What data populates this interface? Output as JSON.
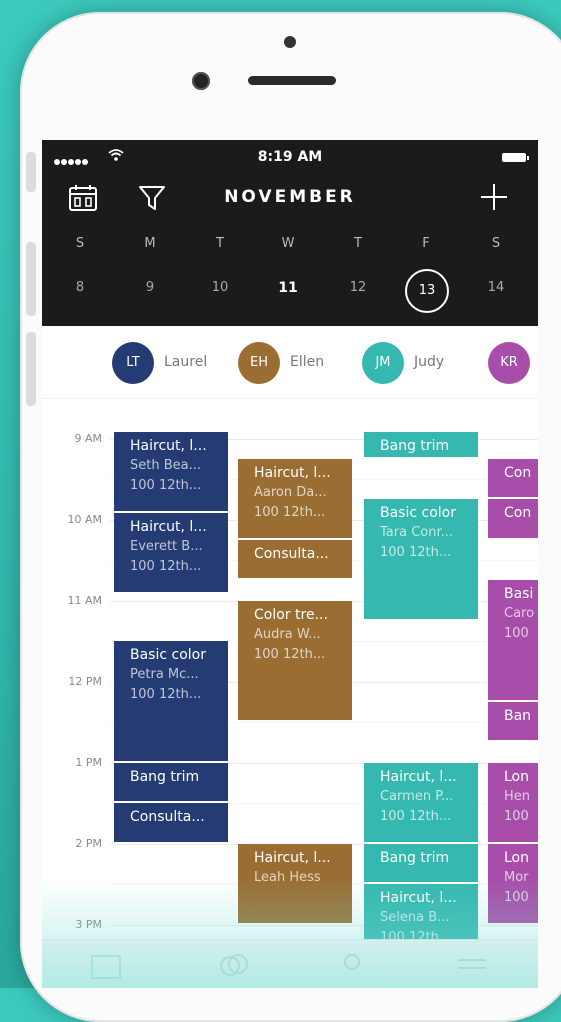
{
  "status_bar": {
    "time": "8:19 AM"
  },
  "header": {
    "month": "NOVEMBER"
  },
  "week": {
    "days": [
      "S",
      "M",
      "T",
      "W",
      "T",
      "F",
      "S"
    ],
    "dates": [
      "8",
      "9",
      "10",
      "11",
      "12",
      "13",
      "14"
    ],
    "today_index": 3,
    "selected_index": 5
  },
  "staff": [
    {
      "initials": "LT",
      "name": "Laurel",
      "color": "#243b73"
    },
    {
      "initials": "EH",
      "name": "Ellen",
      "color": "#9a6e33"
    },
    {
      "initials": "JM",
      "name": "Judy",
      "color": "#35b8b0"
    },
    {
      "initials": "KR",
      "name": "",
      "color": "#a84eaa"
    }
  ],
  "hours": [
    "9 AM",
    "10 AM",
    "11 AM",
    "12 PM",
    "1 PM",
    "2 PM",
    "3 PM"
  ],
  "appointments": [
    {
      "col": 0,
      "start": 8.92,
      "end": 9.92,
      "title": "Haircut, l...",
      "lines": [
        "Seth Bea...",
        "100 12th..."
      ]
    },
    {
      "col": 0,
      "start": 9.92,
      "end": 10.92,
      "title": "Haircut, l...",
      "lines": [
        "Everett B...",
        "100 12th..."
      ]
    },
    {
      "col": 0,
      "start": 11.5,
      "end": 13.0,
      "title": "Basic color",
      "lines": [
        "Petra Mc...",
        "100 12th..."
      ]
    },
    {
      "col": 0,
      "start": 13.0,
      "end": 13.5,
      "title": "Bang trim",
      "lines": []
    },
    {
      "col": 0,
      "start": 13.5,
      "end": 14.0,
      "title": "Consulta...",
      "lines": []
    },
    {
      "col": 1,
      "start": 9.25,
      "end": 10.25,
      "title": "Haircut, l...",
      "lines": [
        "Aaron Da...",
        "100 12th..."
      ]
    },
    {
      "col": 1,
      "start": 10.25,
      "end": 10.75,
      "title": "Consulta...",
      "lines": []
    },
    {
      "col": 1,
      "start": 11.0,
      "end": 12.5,
      "title": "Color tre...",
      "lines": [
        "Audra W...",
        "100 12th..."
      ]
    },
    {
      "col": 1,
      "start": 14.0,
      "end": 15.0,
      "title": "Haircut, l...",
      "lines": [
        "Leah Hess"
      ]
    },
    {
      "col": 2,
      "start": 8.92,
      "end": 9.25,
      "title": "Bang trim",
      "lines": []
    },
    {
      "col": 2,
      "start": 9.75,
      "end": 11.25,
      "title": "Basic color",
      "lines": [
        "Tara Conr...",
        "100 12th..."
      ]
    },
    {
      "col": 2,
      "start": 13.0,
      "end": 14.0,
      "title": "Haircut, l...",
      "lines": [
        "Carmen P...",
        "100 12th..."
      ]
    },
    {
      "col": 2,
      "start": 14.0,
      "end": 14.5,
      "title": "Bang trim",
      "lines": []
    },
    {
      "col": 2,
      "start": 14.5,
      "end": 15.4,
      "title": "Haircut, l...",
      "lines": [
        "Selena B...",
        "100 12th..."
      ]
    },
    {
      "col": 3,
      "start": 9.25,
      "end": 9.75,
      "title": "Con",
      "lines": []
    },
    {
      "col": 3,
      "start": 9.75,
      "end": 10.25,
      "title": "Con",
      "lines": []
    },
    {
      "col": 3,
      "start": 10.75,
      "end": 12.25,
      "title": "Basi",
      "lines": [
        "Caro",
        "100"
      ]
    },
    {
      "col": 3,
      "start": 12.25,
      "end": 12.75,
      "title": "Ban",
      "lines": []
    },
    {
      "col": 3,
      "start": 13.0,
      "end": 14.0,
      "title": "Lon",
      "lines": [
        "Hen",
        "100"
      ]
    },
    {
      "col": 3,
      "start": 14.0,
      "end": 15.0,
      "title": "Lon",
      "lines": [
        "Mor",
        "100"
      ]
    }
  ]
}
